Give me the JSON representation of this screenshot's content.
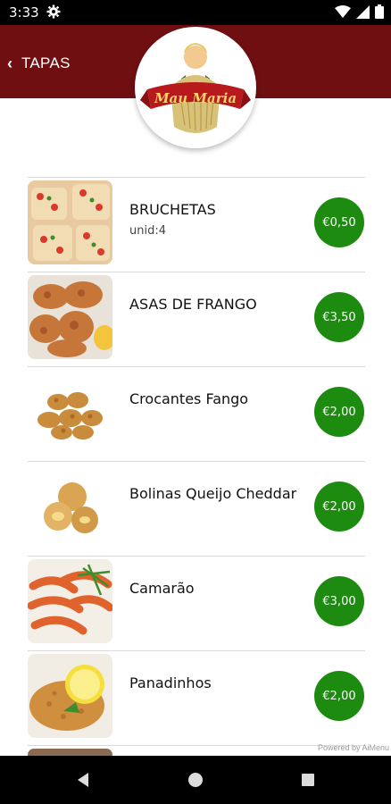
{
  "status": {
    "time": "3:33"
  },
  "header": {
    "back_label": "TAPAS"
  },
  "logo": {
    "brand": "Mau Maria"
  },
  "colors": {
    "header": "#6f0f12",
    "price": "#1d8a10"
  },
  "items": [
    {
      "name": "BRUCHETAS",
      "sub": "unid:4",
      "price": "€0,50"
    },
    {
      "name": "ASAS DE FRANGO",
      "sub": "",
      "price": "€3,50"
    },
    {
      "name": "Crocantes Fango",
      "sub": "",
      "price": "€2,00"
    },
    {
      "name": "Bolinas Queijo Cheddar",
      "sub": "",
      "price": "€2,00"
    },
    {
      "name": "Camarão",
      "sub": "",
      "price": "€3,00"
    },
    {
      "name": "Panadinhos",
      "sub": "",
      "price": "€2,00"
    }
  ],
  "footer": {
    "powered": "Powered by AiMenu"
  }
}
